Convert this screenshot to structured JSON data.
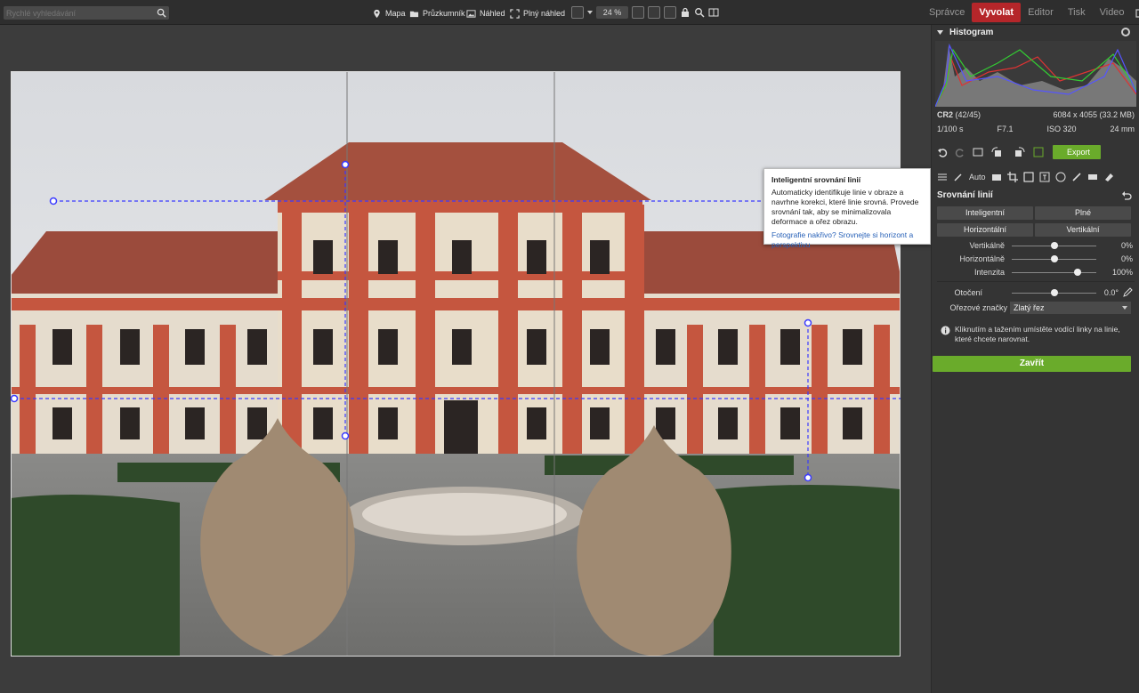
{
  "search": {
    "placeholder": "Rychlé vyhledávání",
    "icon": "search-icon"
  },
  "nav": [
    {
      "label": "Mapa",
      "icon": "map-pin-icon"
    },
    {
      "label": "Průzkumník",
      "icon": "folder-icon"
    },
    {
      "label": "Náhled",
      "icon": "image-icon"
    },
    {
      "label": "Plný náhled",
      "icon": "fullscreen-icon"
    }
  ],
  "toolbar": {
    "zoom": "24 %"
  },
  "modes": [
    {
      "label": "Správce",
      "active": false
    },
    {
      "label": "Vyvolat",
      "active": true
    },
    {
      "label": "Editor",
      "active": false
    },
    {
      "label": "Tisk",
      "active": false
    },
    {
      "label": "Video",
      "active": false
    }
  ],
  "histogram": {
    "title": "Histogram",
    "format": "CR2",
    "index": "(42/45)",
    "size": "6084 x 4055 (33.2 MB)",
    "shutter": "1/100 s",
    "aperture": "F7.1",
    "iso": "ISO 320",
    "focal": "24 mm"
  },
  "export": {
    "label": "Export"
  },
  "toolrow": {
    "auto": "Auto"
  },
  "tooltip": {
    "title": "Inteligentní srovnání linií",
    "body": "Automaticky identifikuje linie v obraze a navrhne korekci, které linie srovná. Provede srovnání tak, aby se minimalizovala deformace a ořez obrazu.",
    "link": "Fotografie nakřivo? Srovnejte si horizont a perspektivu"
  },
  "section": {
    "title": "Srovnání linií",
    "buttons": [
      "Inteligentní",
      "Plné",
      "Horizontální",
      "Vertikální"
    ],
    "sliders": [
      {
        "label": "Vertikálně",
        "value": "0%",
        "pos": 0.5
      },
      {
        "label": "Horizontálně",
        "value": "0%",
        "pos": 0.5
      },
      {
        "label": "Intenzita",
        "value": "100%",
        "pos": 0.78
      }
    ],
    "rotation": {
      "label": "Otočení",
      "value": "0.0°",
      "pos": 0.5
    },
    "crop": {
      "label": "Ořezové značky",
      "value": "Zlatý řez"
    },
    "hint": "Kliknutím a tažením umístěte vodící linky na linie, které chcete narovnat.",
    "close": "Zavřít"
  },
  "colors": {
    "accent": "#b5262a",
    "green": "#6aab2b",
    "guide": "#3a3aff"
  }
}
